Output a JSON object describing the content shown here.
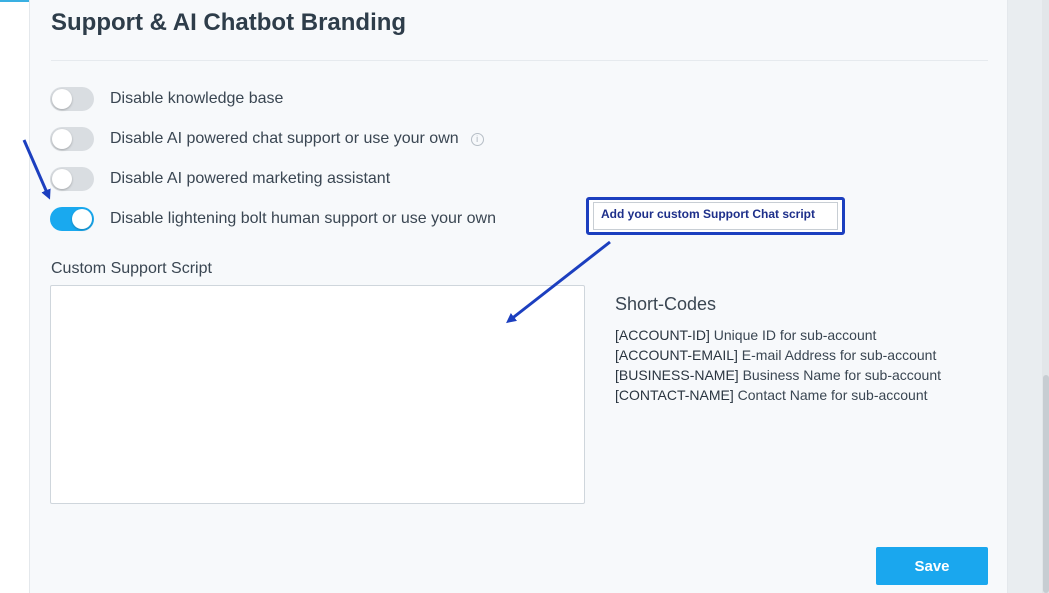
{
  "section": {
    "title": "Support & AI Chatbot Branding"
  },
  "toggles": [
    {
      "label": "Disable knowledge base",
      "enabled": false
    },
    {
      "label": "Disable AI powered chat support or use your own",
      "enabled": false,
      "info_icon": "i"
    },
    {
      "label": "Disable AI powered marketing assistant",
      "enabled": false
    },
    {
      "label": "Disable lightening bolt human support or use your own",
      "enabled": true
    }
  ],
  "custom_script": {
    "label": "Custom Support Script",
    "value": ""
  },
  "short_codes": {
    "title": "Short-Codes",
    "items": [
      {
        "code": "[ACCOUNT-ID]",
        "desc": "Unique ID for sub-account"
      },
      {
        "code": "[ACCOUNT-EMAIL]",
        "desc": "E-mail Address for sub-account"
      },
      {
        "code": "[BUSINESS-NAME]",
        "desc": "Business Name for sub-account"
      },
      {
        "code": "[CONTACT-NAME]",
        "desc": "Contact Name for sub-account"
      }
    ]
  },
  "annotation": {
    "callout_text": "Add your custom Support Chat script"
  },
  "actions": {
    "save_label": "Save"
  },
  "colors": {
    "accent": "#19a9ef",
    "annotation": "#1c3fbf"
  }
}
